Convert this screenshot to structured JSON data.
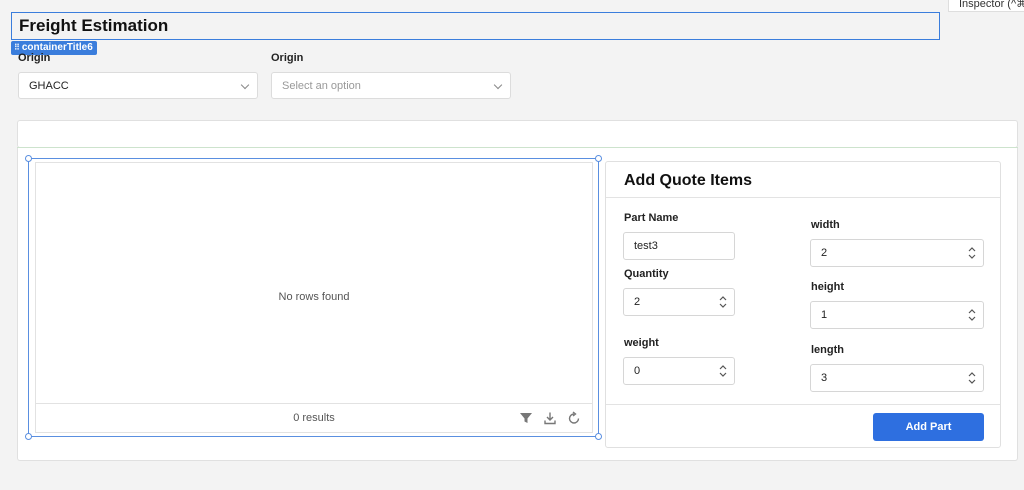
{
  "inspector": {
    "label": "Inspector (^⌘I)"
  },
  "page": {
    "title": "Freight Estimation",
    "component_tag": "containerTitle6"
  },
  "filters": {
    "origin1": {
      "label": "Origin",
      "value": "GHACC"
    },
    "origin2": {
      "label": "Origin",
      "placeholder": "Select an option"
    }
  },
  "table": {
    "empty_text": "No rows found",
    "results_text": "0 results",
    "tools": [
      "filter-icon",
      "download-icon",
      "refresh-icon"
    ]
  },
  "quote": {
    "title": "Add Quote Items",
    "part_name": {
      "label": "Part Name",
      "value": "test3"
    },
    "quantity": {
      "label": "Quantity",
      "value": "2"
    },
    "weight": {
      "label": "weight",
      "value": "0"
    },
    "width": {
      "label": "width",
      "value": "2"
    },
    "height": {
      "label": "height",
      "value": "1"
    },
    "length": {
      "label": "length",
      "value": "3"
    },
    "add_button": "Add Part"
  },
  "colors": {
    "accent": "#2e6fe0",
    "selection": "#3a7ddc",
    "background": "#f3f3f3"
  }
}
